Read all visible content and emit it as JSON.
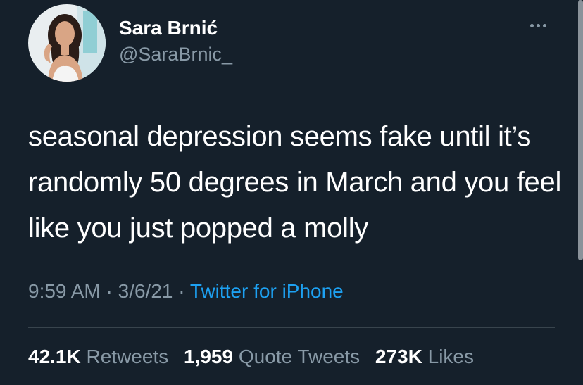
{
  "author": {
    "display_name": "Sara Brnić",
    "handle": "@SaraBrnic_",
    "avatar_icon": "profile-photo"
  },
  "tweet": {
    "text": "seasonal depression seems fake until it’s randomly 50 degrees in March and you feel like you just popped a molly",
    "time": "9:59 AM",
    "date": "3/6/21",
    "separator": "·",
    "source": "Twitter for iPhone"
  },
  "stats": {
    "retweets_count": "42.1K",
    "retweets_label": "Retweets",
    "quote_count": "1,959",
    "quote_label": "Quote Tweets",
    "likes_count": "273K",
    "likes_label": "Likes"
  },
  "colors": {
    "background": "#15202b",
    "primary_text": "#ffffff",
    "secondary_text": "#8899a6",
    "accent": "#1da1f2",
    "divider": "#38444d"
  }
}
